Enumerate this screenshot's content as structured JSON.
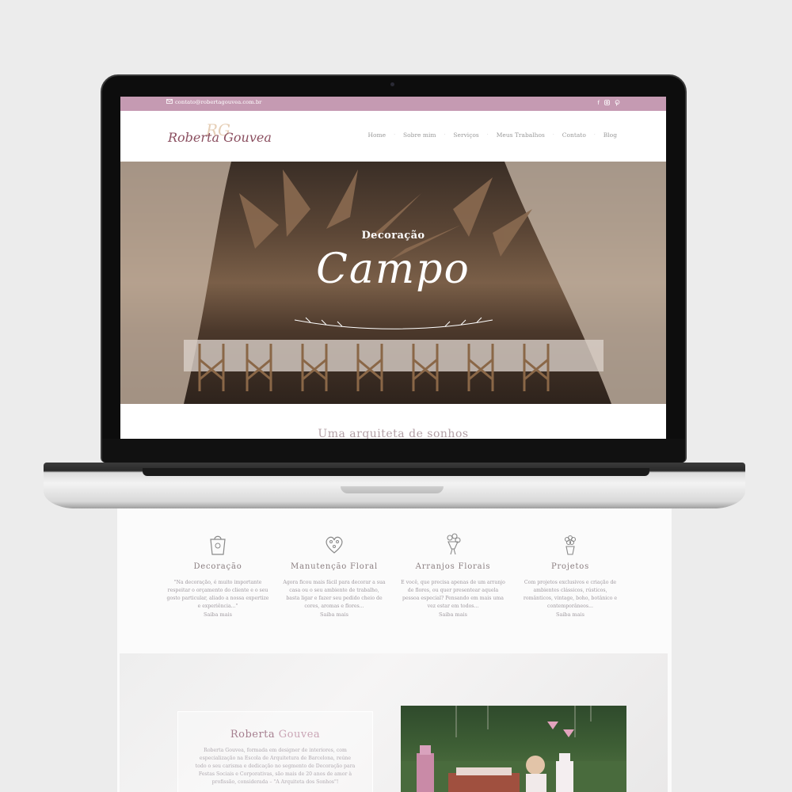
{
  "topbar": {
    "email": "contato@robertagouvea.com.br",
    "social": [
      "f",
      "IG",
      "P"
    ]
  },
  "logo": {
    "monogram": "RG",
    "name": "Roberta Gouvea"
  },
  "nav": {
    "items": [
      "Home",
      "Sobre mim",
      "Serviços",
      "Meus Trabalhos",
      "Contato",
      "Blog"
    ]
  },
  "hero": {
    "subtitle": "Decoração",
    "title": "Campo"
  },
  "section": {
    "title": "Uma arquiteta de sonhos"
  },
  "services": [
    {
      "title": "Decoração",
      "text_lines": [
        "\"Na decoração, é muito importante",
        "respeitar o orçamento do cliente e o seu",
        "gosto particular, aliado a nossa expertize",
        "e experiência...\""
      ],
      "more": "Saiba mais",
      "icon": "gift-bag-icon"
    },
    {
      "title": "Manutenção Floral",
      "text_lines": [
        "Agora ficou mais fácil para decorar a sua",
        "casa ou o seu ambiente de trabalho,",
        "basta ligar e fazer seu pedido cheio de",
        "cores, aromas e flores..."
      ],
      "more": "Saiba mais",
      "icon": "heart-wreath-icon"
    },
    {
      "title": "Arranjos Florais",
      "text_lines": [
        "E você, que precisa apenas de um arranjo",
        "de flores, ou quer presentear aquela",
        "pessoa especial? Pensando em mais uma",
        "vez estar em todos..."
      ],
      "more": "Saiba mais",
      "icon": "bouquet-icon"
    },
    {
      "title": "Projetos",
      "text_lines": [
        "Com projetos exclusivos e criação de",
        "ambientes clássicos, rústicos,",
        "românticos, vintage, boho, botânico e",
        "contemporâneos..."
      ],
      "more": "Saiba mais",
      "icon": "flower-pot-icon"
    }
  ],
  "about": {
    "title_first": "Roberta",
    "title_second": "Gouvea",
    "text_lines": [
      "Roberta Gouvea, formada em designer de interiores, com",
      "especialização na Escola de Arquitetura de Barcelona, reúne",
      "todo o seu carisma e dedicação no segmento de Decoração para",
      "Festas Sociais e Corporativas, são mais de 20 anos de amor à",
      "profissão, considerada – \"A Arquiteta dos Sonhos\"!"
    ]
  },
  "colors": {
    "brand_pink": "#c59ab2",
    "logo_wine": "#8b4f60",
    "hero_brown": "#5a4535"
  }
}
